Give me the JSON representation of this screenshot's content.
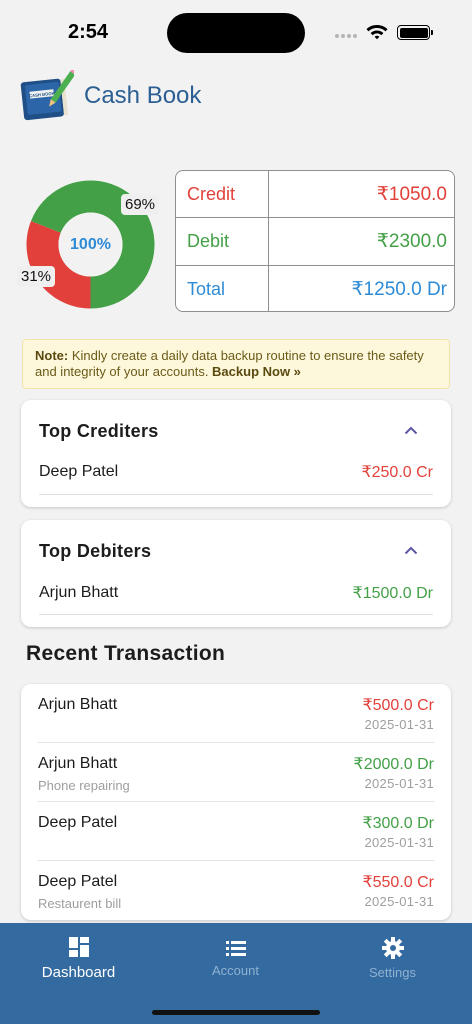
{
  "status_bar": {
    "time": "2:54"
  },
  "header": {
    "title": "Cash Book",
    "logo_text": "CASH BOOK"
  },
  "summary": {
    "donut_center": "100%",
    "credit_percent": "69%",
    "debit_percent": "31%",
    "credit_fraction": 0.69,
    "debit_fraction": 0.31,
    "credit_label": "Credit",
    "credit_value": "₹1050.0",
    "debit_label": "Debit",
    "debit_value": "₹2300.0",
    "total_label": "Total",
    "total_value": "₹1250.0 Dr"
  },
  "note": {
    "prefix": "Note:",
    "text": " Kindly create a daily data backup routine to ensure the safety and integrity of your accounts. ",
    "link": "Backup Now »"
  },
  "top_crediters": {
    "title": "Top Crediters",
    "items": [
      {
        "name": "Deep Patel",
        "amount": "₹250.0 Cr"
      }
    ]
  },
  "top_debiters": {
    "title": "Top Debiters",
    "items": [
      {
        "name": "Arjun Bhatt",
        "amount": "₹1500.0 Dr"
      }
    ]
  },
  "recent": {
    "title": "Recent Transaction",
    "items": [
      {
        "name": "Arjun Bhatt",
        "note": "",
        "amount": "₹500.0 Cr",
        "date": "2025-01-31",
        "type": "cr"
      },
      {
        "name": "Arjun Bhatt",
        "note": "Phone repairing",
        "amount": "₹2000.0 Dr",
        "date": "2025-01-31",
        "type": "dr"
      },
      {
        "name": "Deep Patel",
        "note": "",
        "amount": "₹300.0 Dr",
        "date": "2025-01-31",
        "type": "dr"
      },
      {
        "name": "Deep Patel",
        "note": "Restaurent bill",
        "amount": "₹550.0 Cr",
        "date": "2025-01-31",
        "type": "cr"
      }
    ]
  },
  "nav": {
    "items": [
      {
        "label": "Dashboard",
        "icon": "dashboard-icon",
        "active": true
      },
      {
        "label": "Account",
        "icon": "list-icon",
        "active": false
      },
      {
        "label": "Settings",
        "icon": "gear-icon",
        "active": false
      }
    ]
  },
  "colors": {
    "brand": "#336aa0",
    "credit": "#e2403a",
    "debit": "#43a047",
    "total": "#2e8bd6",
    "accent_chevron": "#5b57a3"
  }
}
